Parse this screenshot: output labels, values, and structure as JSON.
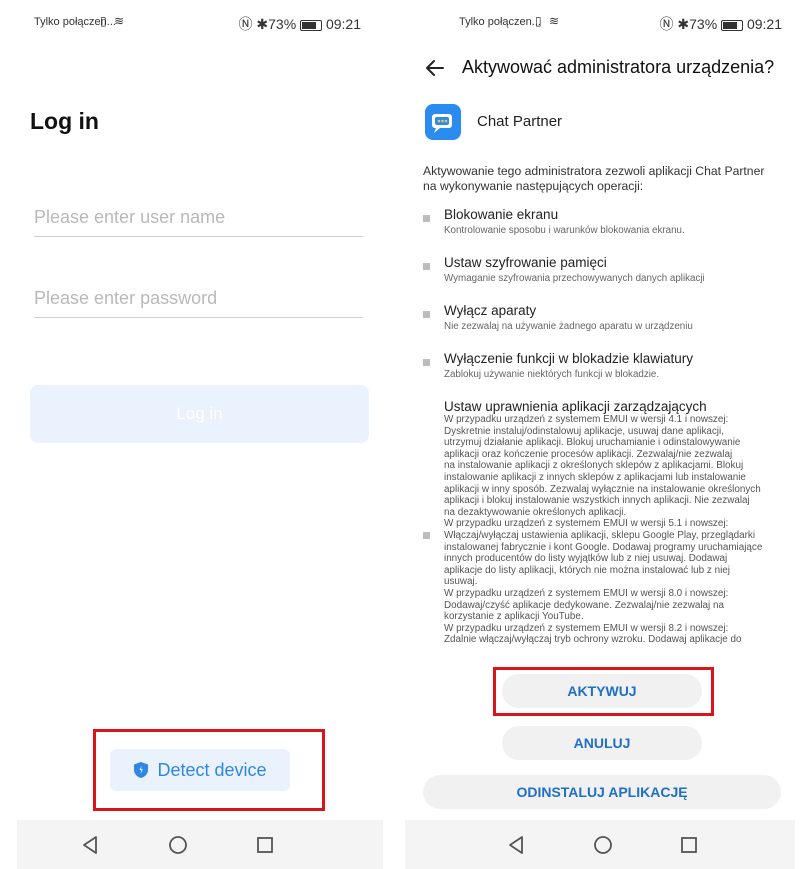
{
  "left": {
    "status": {
      "carrier": "Tylko połączen...",
      "battery": "73%",
      "time": "09:21"
    },
    "title": "Log in",
    "username_placeholder": "Please enter user name",
    "password_placeholder": "Please enter password",
    "login_label": "Log in",
    "detect_label": "Detect device"
  },
  "right": {
    "status": {
      "carrier": "Tylko połączen...",
      "battery": "73%",
      "time": "09:21"
    },
    "title": "Aktywować administratora urządzenia?",
    "app_name": "Chat Partner",
    "intro_line1": "Aktywowanie tego administratora zezwoli aplikacji Chat Partner",
    "intro_line2": "na wykonywanie następujących operacji:",
    "permissions": [
      {
        "title": "Blokowanie ekranu",
        "desc": "Kontrolowanie sposobu i warunków blokowania ekranu."
      },
      {
        "title": "Ustaw szyfrowanie pamięci",
        "desc": "Wymaganie szyfrowania przechowywanych danych aplikacji"
      },
      {
        "title": "Wyłącz aparaty",
        "desc": "Nie zezwalaj na używanie żadnego aparatu w urządzeniu"
      },
      {
        "title": "Wyłączenie funkcji w blokadzie klawiatury",
        "desc": "Zablokuj używanie niektórych funkcji w blokadzie."
      },
      {
        "title": "Ustaw uprawnienia aplikacji zarządzających"
      }
    ],
    "long_desc_lines": [
      "W przypadku urządzeń z systemem EMUI w wersji 4.1 i nowszej:",
      "Dyskretnie instaluj/odinstalowuj aplikacje, usuwaj dane aplikacji,",
      "utrzymuj działanie aplikacji. Blokuj uruchamianie i odinstalowywanie",
      "aplikacji oraz kończenie procesów aplikacji. Zezwalaj/nie zezwalaj",
      "na instalowanie aplikacji z określonych sklepów z aplikacjami. Blokuj",
      "instalowanie aplikacji z innych sklepów z aplikacjami lub instalowanie",
      "aplikacji w inny sposób. Zezwalaj wyłącznie na instalowanie określonych",
      "aplikacji i blokuj instalowanie wszystkich innych aplikacji. Nie zezwalaj",
      "na dezaktywowanie określonych aplikacji.",
      "W przypadku urządzeń z systemem EMUI w wersji 5.1 i nowszej:",
      "Włączaj/wyłączaj ustawienia aplikacji, sklepu Google Play, przeglądarki",
      "instalowanej fabrycznie i kont Google. Dodawaj programy uruchamiające",
      "innych producentów do listy wyjątków lub z niej usuwaj. Dodawaj",
      "aplikacje do listy aplikacji, których nie można instalować lub z niej",
      "usuwaj.",
      "W przypadku urządzeń z systemem EMUI w wersji 8.0 i nowszej:",
      "Dodawaj/czyść aplikacje dedykowane. Zezwalaj/nie zezwalaj na",
      "korzystanie z aplikacji YouTube.",
      "W przypadku urządzeń z systemem EMUI w wersji 8.2 i nowszej:",
      "Zdalnie włączaj/wyłączaj tryb ochrony wzroku. Dodawaj aplikacje do"
    ],
    "buttons": {
      "activate": "AKTYWUJ",
      "cancel": "ANULUJ",
      "uninstall": "ODINSTALUJ APLIKACJĘ"
    }
  },
  "colors": {
    "accent": "#2f86e4",
    "highlight": "#d9151b",
    "button_text": "#1f6fc7"
  }
}
